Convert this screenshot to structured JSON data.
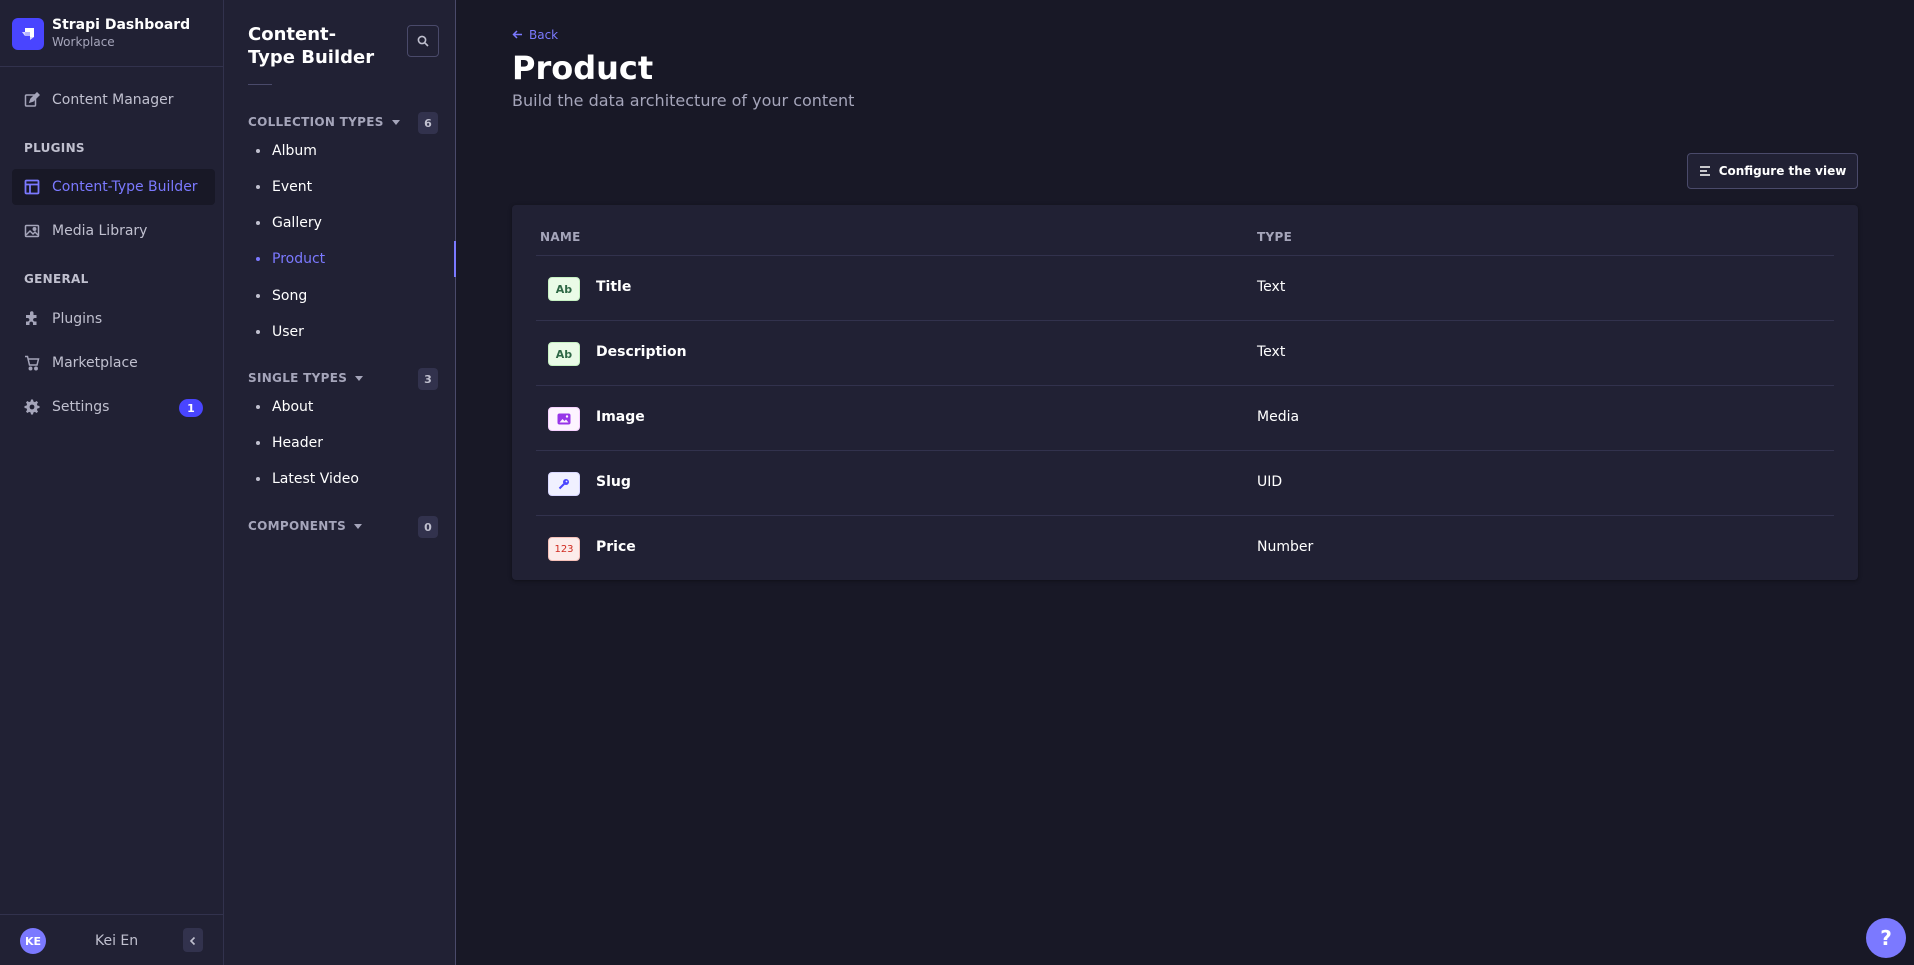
{
  "brand": {
    "title": "Strapi Dashboard",
    "subtitle": "Workplace",
    "logo_icon": "strapi-logo-icon",
    "accent": "#4945ff"
  },
  "mainnav": {
    "content_manager": "Content Manager",
    "plugins_section": "PLUGINS",
    "content_type_builder": "Content-Type Builder",
    "media_library": "Media Library",
    "general_section": "GENERAL",
    "plugins": "Plugins",
    "marketplace": "Marketplace",
    "settings": "Settings",
    "settings_badge": "1"
  },
  "user": {
    "initials": "KE",
    "name": "Kei En"
  },
  "subnav": {
    "title": "Content-Type Builder",
    "collection_types": {
      "label": "COLLECTION TYPES",
      "count": "6",
      "items": [
        "Album",
        "Event",
        "Gallery",
        "Product",
        "Song",
        "User"
      ]
    },
    "single_types": {
      "label": "SINGLE TYPES",
      "count": "3",
      "items": [
        "About",
        "Header",
        "Latest Video"
      ]
    },
    "components": {
      "label": "COMPONENTS",
      "count": "0"
    },
    "active_item": "Product"
  },
  "main": {
    "back": "Back",
    "title": "Product",
    "subtitle": "Build the data architecture of your content",
    "configure_button": "Configure the view",
    "columns": {
      "name": "NAME",
      "type": "TYPE"
    },
    "fields": [
      {
        "icon_label": "Ab",
        "icon": "text-type-icon",
        "name": "Title",
        "type": "Text"
      },
      {
        "icon_label": "Ab",
        "icon": "text-type-icon",
        "name": "Description",
        "type": "Text"
      },
      {
        "icon_label": "",
        "icon": "media-type-icon",
        "name": "Image",
        "type": "Media"
      },
      {
        "icon_label": "",
        "icon": "uid-type-icon",
        "name": "Slug",
        "type": "UID"
      },
      {
        "icon_label": "123",
        "icon": "number-type-icon",
        "name": "Price",
        "type": "Number"
      }
    ]
  },
  "help": "?"
}
